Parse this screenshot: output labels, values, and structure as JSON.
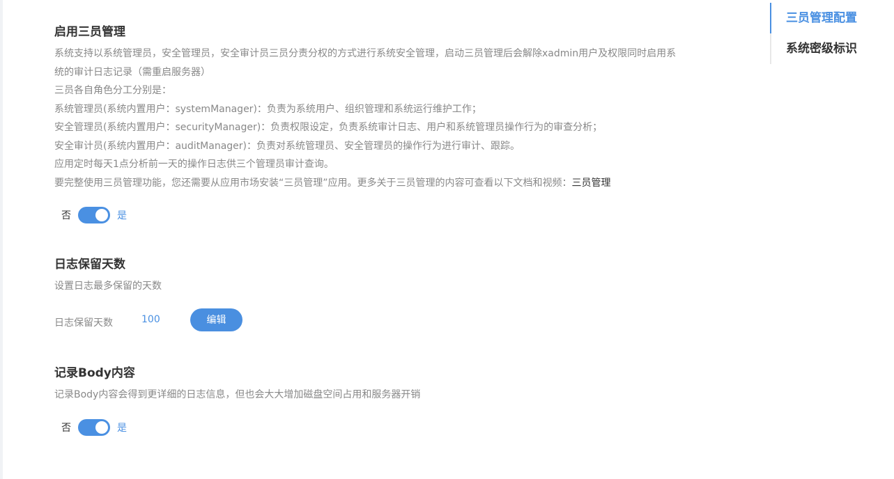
{
  "sections": {
    "three_admins": {
      "title": "启用三员管理",
      "description_lines": [
        "系统支持以系统管理员，安全管理员，安全审计员三员分责分权的方式进行系统安全管理，启动三员管理后会解除xadmin用户及权限同时启用系",
        "统的审计日志记录（需重启服务器）",
        "三员各自角色分工分别是：",
        "系统管理员(系统内置用户：systemManager)：负责为系统用户、组织管理和系统运行维护工作；",
        "安全管理员(系统内置用户：securityManager)：负责权限设定，负责系统审计日志、用户和系统管理员操作行为的审查分析；",
        "安全审计员(系统内置用户：auditManager)：负责对系统管理员、安全管理员的操作行为进行审计、跟踪。",
        "应用定时每天1点分析前一天的操作日志供三个管理员审计查询。",
        "要完整使用三员管理功能，您还需要从应用市场安装“三员管理”应用。更多关于三员管理的内容可查看以下文档和视频："
      ],
      "doc_link": "三员管理",
      "switch_off_label": "否",
      "switch_on_label": "是",
      "enabled": true
    },
    "log_retention": {
      "title": "日志保留天数",
      "description": "设置日志最多保留的天数",
      "field_label": "日志保留天数",
      "field_value": "100",
      "edit_label": "编辑"
    },
    "record_body": {
      "title": "记录Body内容",
      "description": "记录Body内容会得到更详细的日志信息，但也会大大增加磁盘空间占用和服务器开销",
      "switch_off_label": "否",
      "switch_on_label": "是",
      "enabled": true
    }
  },
  "anchor_nav": {
    "items": [
      {
        "label": "三员管理配置",
        "active": true
      },
      {
        "label": "系统密级标识",
        "active": false
      }
    ]
  },
  "colors": {
    "accent": "#4a90e2",
    "text": "#333333",
    "muted": "#888888"
  }
}
